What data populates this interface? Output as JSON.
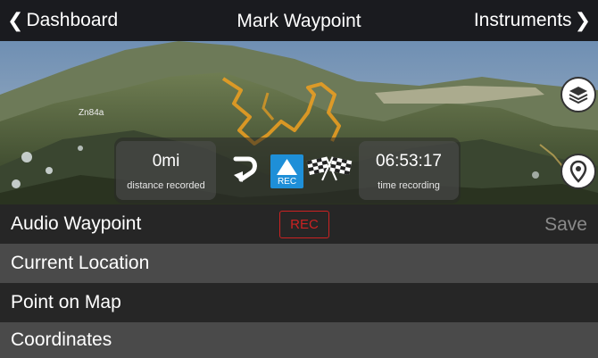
{
  "navbar": {
    "back_label": "Dashboard",
    "title": "Mark Waypoint",
    "forward_label": "Instruments",
    "back_icon": "chevron-left-icon",
    "forward_icon": "chevron-right-icon"
  },
  "map": {
    "place_label": "Zn84a",
    "layers_icon": "layers-icon",
    "pin_icon": "map-pin-icon"
  },
  "stats": {
    "distance_value": "0mi",
    "distance_label": "distance recorded",
    "time_value": "06:53:17",
    "time_label": "time recording",
    "rec_icon_label": "REC",
    "undo_icon": "undo-arrow-icon",
    "flags_icon": "checkered-flags-icon"
  },
  "rows": {
    "audio": "Audio Waypoint",
    "rec_button": "REC",
    "save": "Save",
    "current_location": "Current Location",
    "point_on_map": "Point on Map",
    "coordinates": "Coordinates"
  },
  "colors": {
    "accent_blue": "#1e8fd8",
    "rec_red": "#cc2222",
    "track_orange": "#f0a020"
  }
}
